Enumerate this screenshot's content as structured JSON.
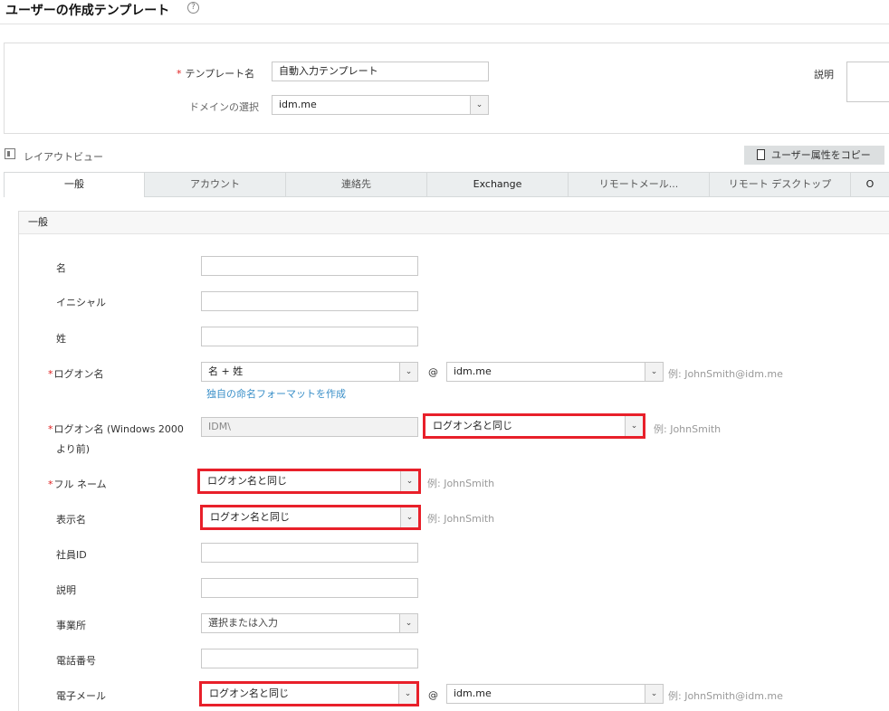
{
  "header": {
    "title": "ユーザーの作成テンプレート",
    "help_icon": "?"
  },
  "template_panel": {
    "template_name_label": "テンプレート名",
    "template_name_value": "自動入力テンプレート",
    "domain_label": "ドメインの選択",
    "domain_value": "idm.me",
    "description_label": "説明"
  },
  "layout_view_label": "レイアウトビュー",
  "copy_button": "ユーザー属性をコピー",
  "tabs": [
    "一般",
    "アカウント",
    "連絡先",
    "Exchange",
    "リモートメール...",
    "リモート デスクトップ",
    "O"
  ],
  "section_title": "一般",
  "fields": {
    "first_name": "名",
    "initials": "イニシャル",
    "last_name": "姓",
    "logon_name": "ログオン名",
    "logon_format": "名 + 姓",
    "at": "@",
    "logon_domain": "idm.me",
    "logon_example": "例: JohnSmith@idm.me",
    "custom_format_link": "独自の命名フォーマットを作成",
    "pre2000_label1": "ログオン名 (Windows 2000",
    "pre2000_label2": "より前)",
    "pre2000_prefix": "IDM\\",
    "pre2000_value": "ログオン名と同じ",
    "pre2000_example": "例: JohnSmith",
    "full_name": "フル ネーム",
    "full_name_value": "ログオン名と同じ",
    "full_name_example": "例: JohnSmith",
    "display_name": "表示名",
    "display_name_value": "ログオン名と同じ",
    "display_name_example": "例: JohnSmith",
    "employee_id": "社員ID",
    "description": "説明",
    "office": "事業所",
    "office_placeholder": "選択または入力",
    "phone": "電話番号",
    "email": "電子メール",
    "email_value": "ログオン名と同じ",
    "email_at": "@",
    "email_domain": "idm.me",
    "email_example": "例: JohnSmith@idm.me"
  },
  "required_mark": "*",
  "highlight_color": "#e8202a"
}
